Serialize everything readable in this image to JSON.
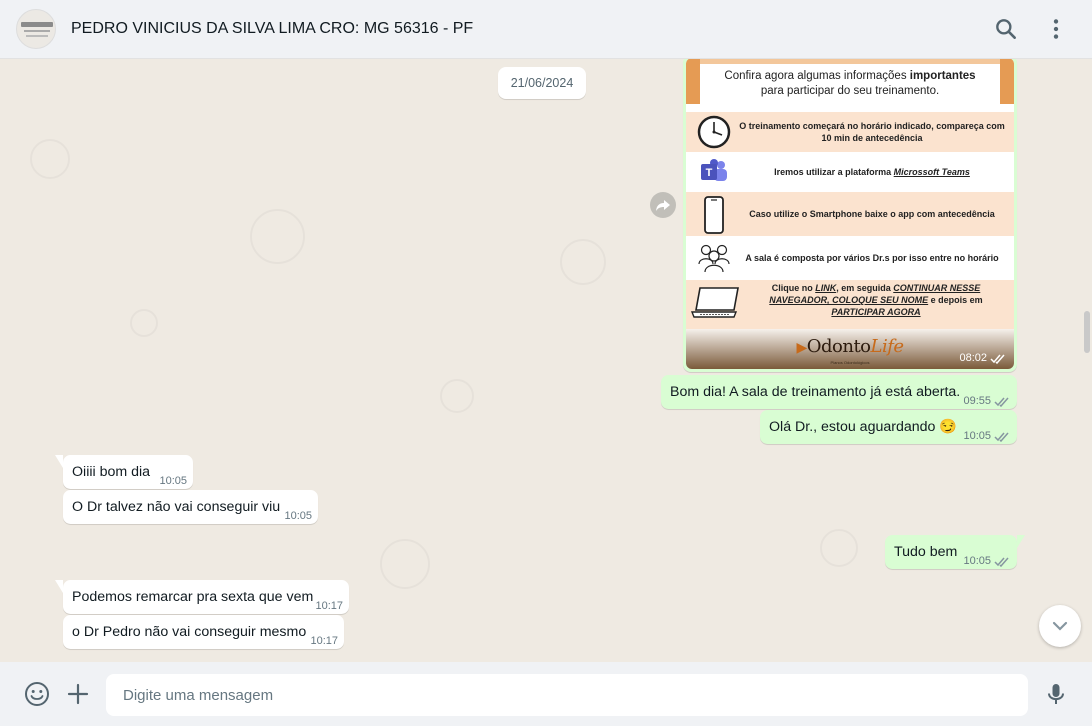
{
  "header": {
    "contact_name": "PEDRO VINICIUS DA SILVA LIMA CRO: MG 56316 - PF",
    "avatar_icon": "avatar-logo-icon",
    "search_icon": "search-icon",
    "menu_icon": "kebab-menu-icon"
  },
  "chat": {
    "date_chip": "21/06/2024",
    "image_message": {
      "banner_line1_prefix": "Confira agora algumas informações ",
      "banner_line1_bold": "importantes",
      "banner_line2": "para participar do seu treinamento.",
      "rows": [
        {
          "icon": "clock-icon",
          "text": "O treinamento começará no horário indicado, compareça com 10 min de antecedência"
        },
        {
          "icon": "teams-icon",
          "text_prefix": "Iremos utilizar a plataforma ",
          "text_link": "Microssoft Teams"
        },
        {
          "icon": "smartphone-icon",
          "text": "Caso utilize o Smartphone baixe o app com antecedência"
        },
        {
          "icon": "people-icon",
          "text": "A sala é composta por vários Dr.s por isso entre no horário"
        },
        {
          "icon": "laptop-icon",
          "text_a": "Clique no ",
          "text_b": "LINK",
          "text_c": ", em seguida ",
          "text_d": "CONTINUAR NESSE NAVEGADOR, COLOQUE SEU NOME",
          "text_e": " e depois em ",
          "text_f": "PARTICIPAR AGORA"
        }
      ],
      "brand_main": "Odonto",
      "brand_life": "Life",
      "brand_sub": "Planos Odontológicos",
      "time": "08:02"
    },
    "messages": [
      {
        "direction": "out",
        "text": "Bom dia! A sala de treinamento já está aberta.",
        "time": "09:55",
        "status": "read"
      },
      {
        "direction": "out",
        "text": "Olá Dr., estou aguardando 😏",
        "time": "10:05",
        "status": "read"
      },
      {
        "direction": "in",
        "text": "Oiiii bom dia",
        "time": "10:05"
      },
      {
        "direction": "in",
        "text": "O Dr talvez não vai conseguir viu",
        "time": "10:05"
      },
      {
        "direction": "out",
        "text": "Tudo bem",
        "time": "10:05",
        "status": "read"
      },
      {
        "direction": "in",
        "text": "Podemos remarcar pra sexta que vem",
        "time": "10:17"
      },
      {
        "direction": "in",
        "text": "o Dr Pedro não vai conseguir mesmo",
        "time": "10:17"
      }
    ]
  },
  "composer": {
    "placeholder": "Digite uma mensagem",
    "emoji_icon": "emoji-icon",
    "attach_icon": "plus-icon",
    "mic_icon": "mic-icon"
  },
  "colors": {
    "outgoing_bubble": "#d9fdd3",
    "incoming_bubble": "#ffffff",
    "chat_background": "#efeae2",
    "read_ticks": "#53bdeb"
  }
}
